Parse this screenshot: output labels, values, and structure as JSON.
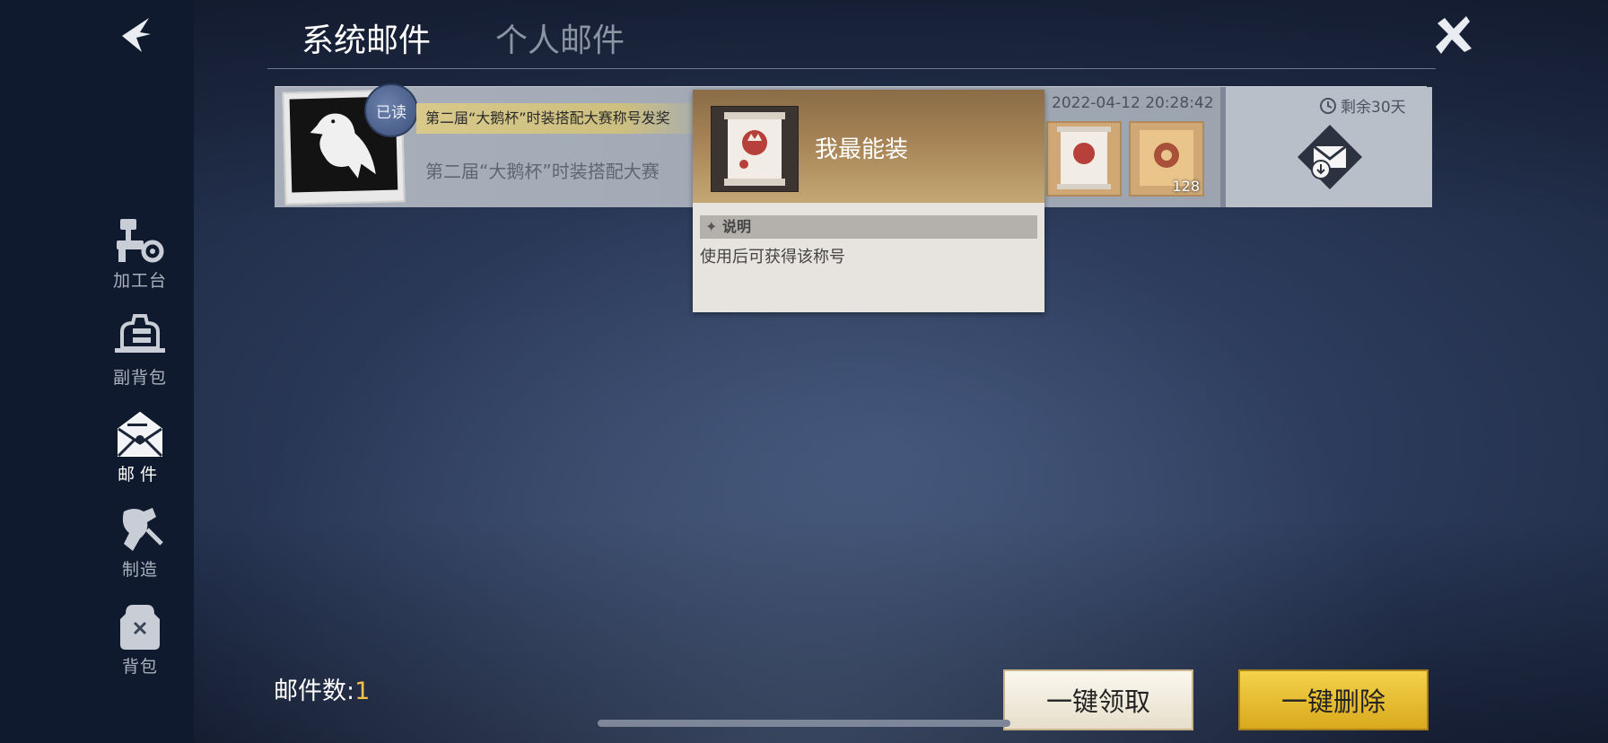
{
  "tabs": [
    {
      "label": "系统邮件",
      "active": true
    },
    {
      "label": "个人邮件",
      "active": false
    }
  ],
  "sidebar": {
    "items": [
      {
        "label": "加工台",
        "icon": "workbench-icon"
      },
      {
        "label": "副背包",
        "icon": "secondary-bag-icon"
      },
      {
        "label": "邮件",
        "icon": "mail-icon",
        "active": true
      },
      {
        "label": "制造",
        "icon": "craft-icon"
      },
      {
        "label": "背包",
        "icon": "backpack-icon"
      }
    ]
  },
  "mail": {
    "read_badge": "已读",
    "subject": "第二届“大鹅杯”时装搭配大赛称号发奖",
    "preview": "第二届“大鹅杯”时装搭配大赛",
    "date": "2022-04-12 20:28:42",
    "expire": "剩余30天",
    "rewards": [
      {
        "icon": "scroll-title-icon",
        "count": ""
      },
      {
        "icon": "gold-ticket-icon",
        "count": "128"
      }
    ]
  },
  "tooltip": {
    "item_name": "我最能装",
    "section_title": "说明",
    "description": "使用后可获得该称号"
  },
  "footer": {
    "mail_count_label": "邮件数:",
    "mail_count_value": "1",
    "claim_all_label": "一键领取",
    "delete_all_label": "一键删除"
  },
  "colors": {
    "accent_gold": "#f3c24b",
    "tab_active": "#ffffff",
    "tab_inactive": "#8b94a3",
    "delete_button": "#e8bb2c"
  }
}
